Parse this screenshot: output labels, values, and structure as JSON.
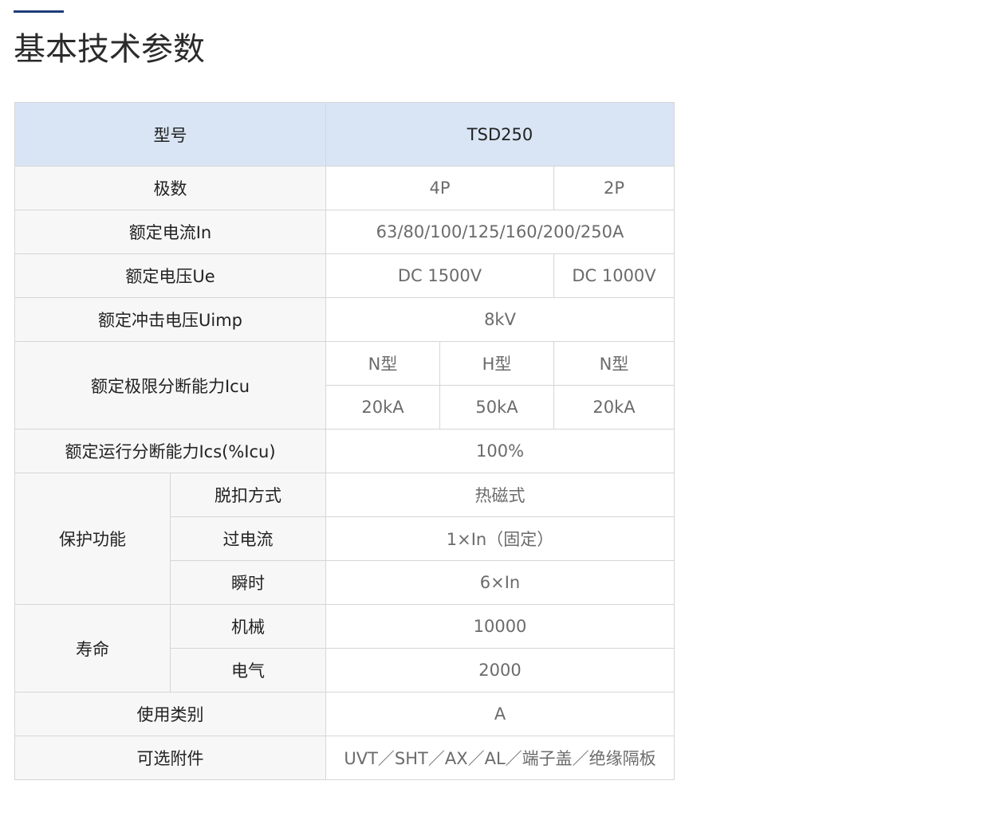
{
  "section": {
    "title": "基本技术参数"
  },
  "table": {
    "header": {
      "label": "型号",
      "model": "TSD250"
    },
    "poles": {
      "label": "极数",
      "v4p": "4P",
      "v2p": "2P"
    },
    "rated_current": {
      "label": "额定电流In",
      "value": "63/80/100/125/160/200/250A"
    },
    "rated_voltage": {
      "label": "额定电压Ue",
      "v4p": "DC 1500V",
      "v2p": "DC 1000V"
    },
    "impulse_voltage": {
      "label": "额定冲击电压Uimp",
      "value": "8kV"
    },
    "icu": {
      "label": "额定极限分断能力Icu",
      "types": [
        "N型",
        "H型",
        "N型"
      ],
      "values": [
        "20kA",
        "50kA",
        "20kA"
      ]
    },
    "ics": {
      "label": "额定运行分断能力Ics(%Icu)",
      "value": "100%"
    },
    "protection": {
      "label": "保护功能",
      "trip_label": "脱扣方式",
      "trip_value": "热磁式",
      "overcurrent_label": "过电流",
      "overcurrent_value": "1×In（固定）",
      "instant_label": "瞬时",
      "instant_value": "6×In"
    },
    "life": {
      "label": "寿命",
      "mech_label": "机械",
      "mech_value": "10000",
      "elec_label": "电气",
      "elec_value": "2000"
    },
    "category": {
      "label": "使用类别",
      "value": "A"
    },
    "accessories": {
      "label": "可选附件",
      "value": "UVT／SHT／AX／AL／端子盖／绝缘隔板"
    }
  },
  "colors": {
    "header_bg": "#d9e5f5",
    "label_bg": "#f7f7f7",
    "accent": "#1e3d7b",
    "border": "#d6d6d6"
  }
}
